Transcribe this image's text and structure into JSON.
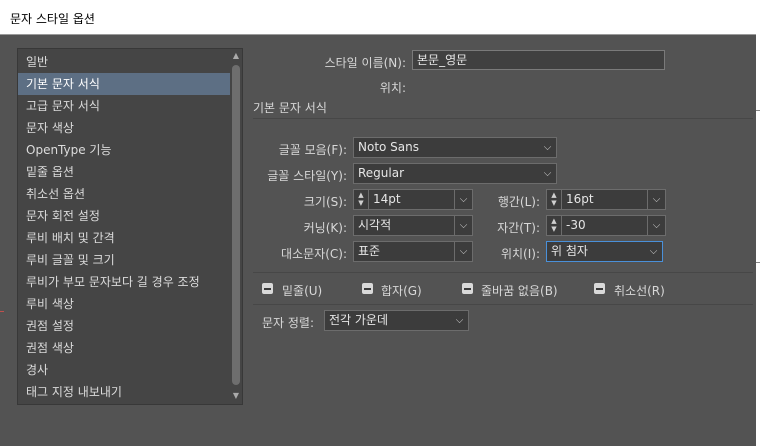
{
  "window": {
    "title": "문자 스타일 옵션"
  },
  "sidebar": {
    "items": [
      {
        "label": "일반"
      },
      {
        "label": "기본 문자 서식"
      },
      {
        "label": "고급 문자 서식"
      },
      {
        "label": "문자 색상"
      },
      {
        "label": "OpenType 기능"
      },
      {
        "label": "밑줄 옵션"
      },
      {
        "label": "취소선 옵션"
      },
      {
        "label": "문자 회전 설정"
      },
      {
        "label": "루비 배치 및 간격"
      },
      {
        "label": "루비 글꼴 및 크기"
      },
      {
        "label": "루비가 부모 문자보다 길 경우 조정"
      },
      {
        "label": "루비 색상"
      },
      {
        "label": "권점 설정"
      },
      {
        "label": "권점 색상"
      },
      {
        "label": "경사"
      },
      {
        "label": "태그 지정 내보내기"
      }
    ],
    "selected": "기본 문자 서식"
  },
  "header": {
    "style_name_label": "스타일 이름(N):",
    "style_name_value": "본문_영문",
    "location_label": "위치:",
    "location_value": "",
    "section_title": "기본 문자 서식"
  },
  "form": {
    "font_family_label": "글꼴 모음(F):",
    "font_family_value": "Noto Sans",
    "font_style_label": "글꼴 스타일(Y):",
    "font_style_value": "Regular",
    "size_label": "크기(S):",
    "size_value": "14pt",
    "leading_label": "행간(L):",
    "leading_value": "16pt",
    "kerning_label": "커닝(K):",
    "kerning_value": "시각적",
    "tracking_label": "자간(T):",
    "tracking_value": "-30",
    "case_label": "대소문자(C):",
    "case_value": "표준",
    "position_label": "위치(I):",
    "position_value": "위 첨자"
  },
  "checkboxes": {
    "underline": "밑줄(U)",
    "ligatures": "합자(G)",
    "no_break": "줄바꿈 없음(B)",
    "strikethrough": "취소선(R)"
  },
  "alignment": {
    "label": "문자 정렬:",
    "value": "전각 가운데"
  },
  "icons": {
    "dropdown": "chevron-down-icon",
    "spinner": "up-down-arrows-icon",
    "checkbox": "indeterminate-checkbox-icon"
  },
  "colors": {
    "panel_bg": "#535353",
    "selected_item": "#5d6f84",
    "focus_border": "#4a90d9"
  }
}
